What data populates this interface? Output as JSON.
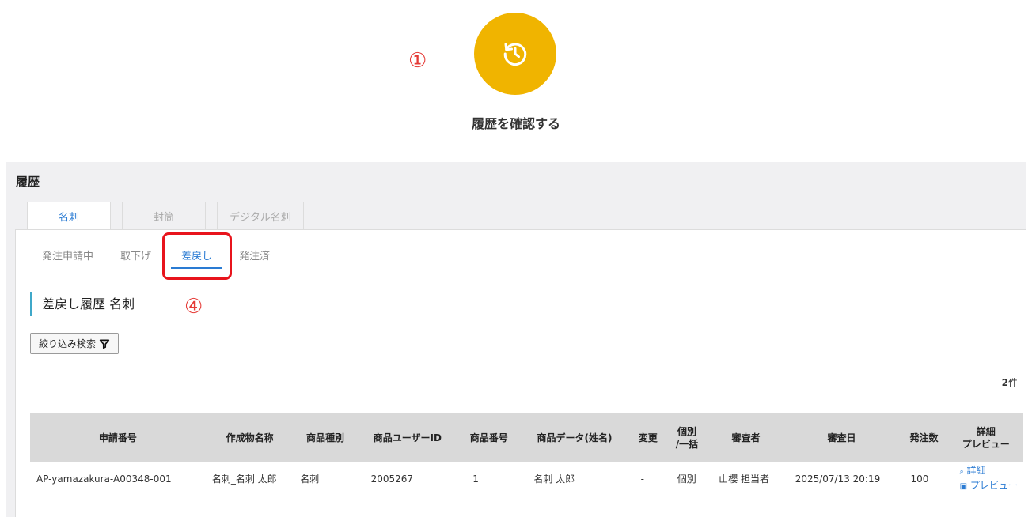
{
  "step_markers": {
    "one": "①",
    "four": "④"
  },
  "history_button": {
    "label": "履歴を確認する",
    "icon": "history-icon",
    "color": "#f0b400"
  },
  "panel": {
    "title": "履歴",
    "tabs": [
      {
        "label": "名刺",
        "active": true
      },
      {
        "label": "封筒",
        "active": false
      },
      {
        "label": "デジタル名刺",
        "active": false
      }
    ],
    "subtabs": [
      {
        "label": "発注申請中",
        "active": false
      },
      {
        "label": "取下げ",
        "active": false
      },
      {
        "label": "差戻し",
        "active": true
      },
      {
        "label": "発注済",
        "active": false
      }
    ],
    "section_title": "差戻し履歴 名刺",
    "filter_button": {
      "label": "絞り込み検索",
      "icon": "filter-icon"
    },
    "count": {
      "number": "2",
      "unit": "件"
    }
  },
  "table": {
    "headers": [
      "申請番号",
      "作成物名称",
      "商品種別",
      "商品ユーザーID",
      "商品番号",
      "商品データ(姓名)",
      "変更",
      "個別\n/一括",
      "審査者",
      "審査日",
      "発注数",
      "詳細\nプレビュー"
    ],
    "rows": [
      {
        "cells": [
          "AP-yamazakura-A00348-001",
          "名刺_名刺 太郎",
          "名刺",
          "2005267",
          "1",
          "名刺 太郎",
          "-",
          "個別",
          "山櫻 担当者",
          "2025/07/13 20:19",
          "100"
        ],
        "detail_link": "詳細",
        "preview_link": "プレビュー"
      }
    ]
  },
  "colors": {
    "accent": "#2a7bd3",
    "highlight": "#e8141c",
    "marker": "#e53935"
  }
}
